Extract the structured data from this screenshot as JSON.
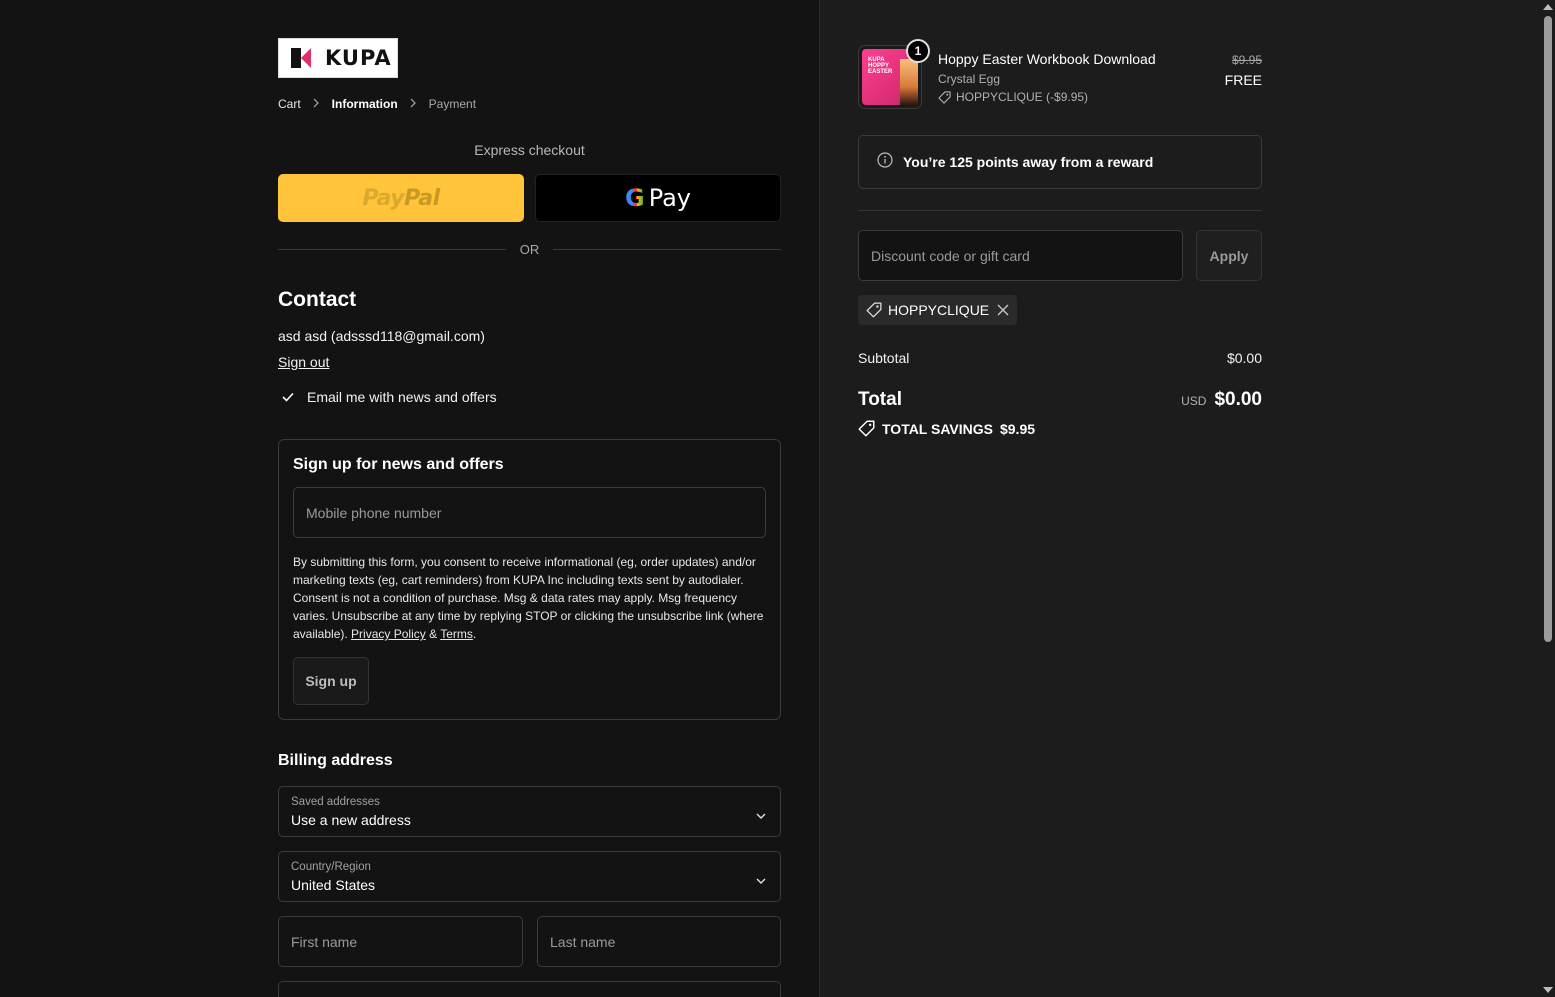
{
  "brand": {
    "logo_text": "KUPA"
  },
  "breadcrumb": {
    "cart": "Cart",
    "information": "Information",
    "payment": "Payment"
  },
  "express": {
    "label": "Express checkout",
    "paypal_pay": "Pay",
    "paypal_pal": "Pal",
    "gpay_g": "G",
    "gpay_pay": "Pay",
    "or": "OR"
  },
  "contact": {
    "heading": "Contact",
    "user_line": "asd asd (adsssd118@gmail.com)",
    "sign_out": "Sign out",
    "email_news_label": "Email me with news and offers",
    "email_news_checked": true
  },
  "signup": {
    "title": "Sign up for news and offers",
    "phone_placeholder": "Mobile phone number",
    "consent_text": "By submitting this form, you consent to receive informational (eg, order updates) and/or marketing texts (eg, cart reminders) from KUPA Inc including texts sent by autodialer. Consent is not a condition of purchase. Msg & data rates may apply. Msg frequency varies. Unsubscribe at any time by replying STOP or clicking the unsubscribe link (where available).",
    "privacy_link": "Privacy Policy",
    "amp": "&",
    "terms_link": "Terms",
    "period": ".",
    "button": "Sign up"
  },
  "billing": {
    "heading": "Billing address",
    "saved_label": "Saved addresses",
    "saved_value": "Use a new address",
    "country_label": "Country/Region",
    "country_value": "United States",
    "first_name_placeholder": "First name",
    "last_name_placeholder": "Last name"
  },
  "order": {
    "item": {
      "quantity": "1",
      "name": "Hoppy Easter Workbook Download",
      "variant": "Crystal Egg",
      "discount": "HOPPYCLIQUE (-$9.95)",
      "price_original": "$9.95",
      "price_final": "FREE",
      "thumb_text_1": "KUPA",
      "thumb_text_2": "HOPPY",
      "thumb_text_3": "EASTER"
    },
    "reward_text": "You’re 125 points away from a reward",
    "discount_placeholder": "Discount code or gift card",
    "apply_button": "Apply",
    "applied_code": "HOPPYCLIQUE",
    "subtotal_label": "Subtotal",
    "subtotal_value": "$0.00",
    "total_label": "Total",
    "total_currency": "USD",
    "total_value": "$0.00",
    "savings_label": "TOTAL SAVINGS",
    "savings_value": "$9.95"
  },
  "colors": {
    "page_bg": "#131313",
    "summary_bg": "#1c1c1c",
    "paypal_yellow": "#ffc439",
    "border": "#3a3a3a"
  },
  "icons": [
    "chevron-right-icon",
    "check-icon",
    "info-icon",
    "tag-icon",
    "close-icon",
    "chevron-down-icon"
  ]
}
